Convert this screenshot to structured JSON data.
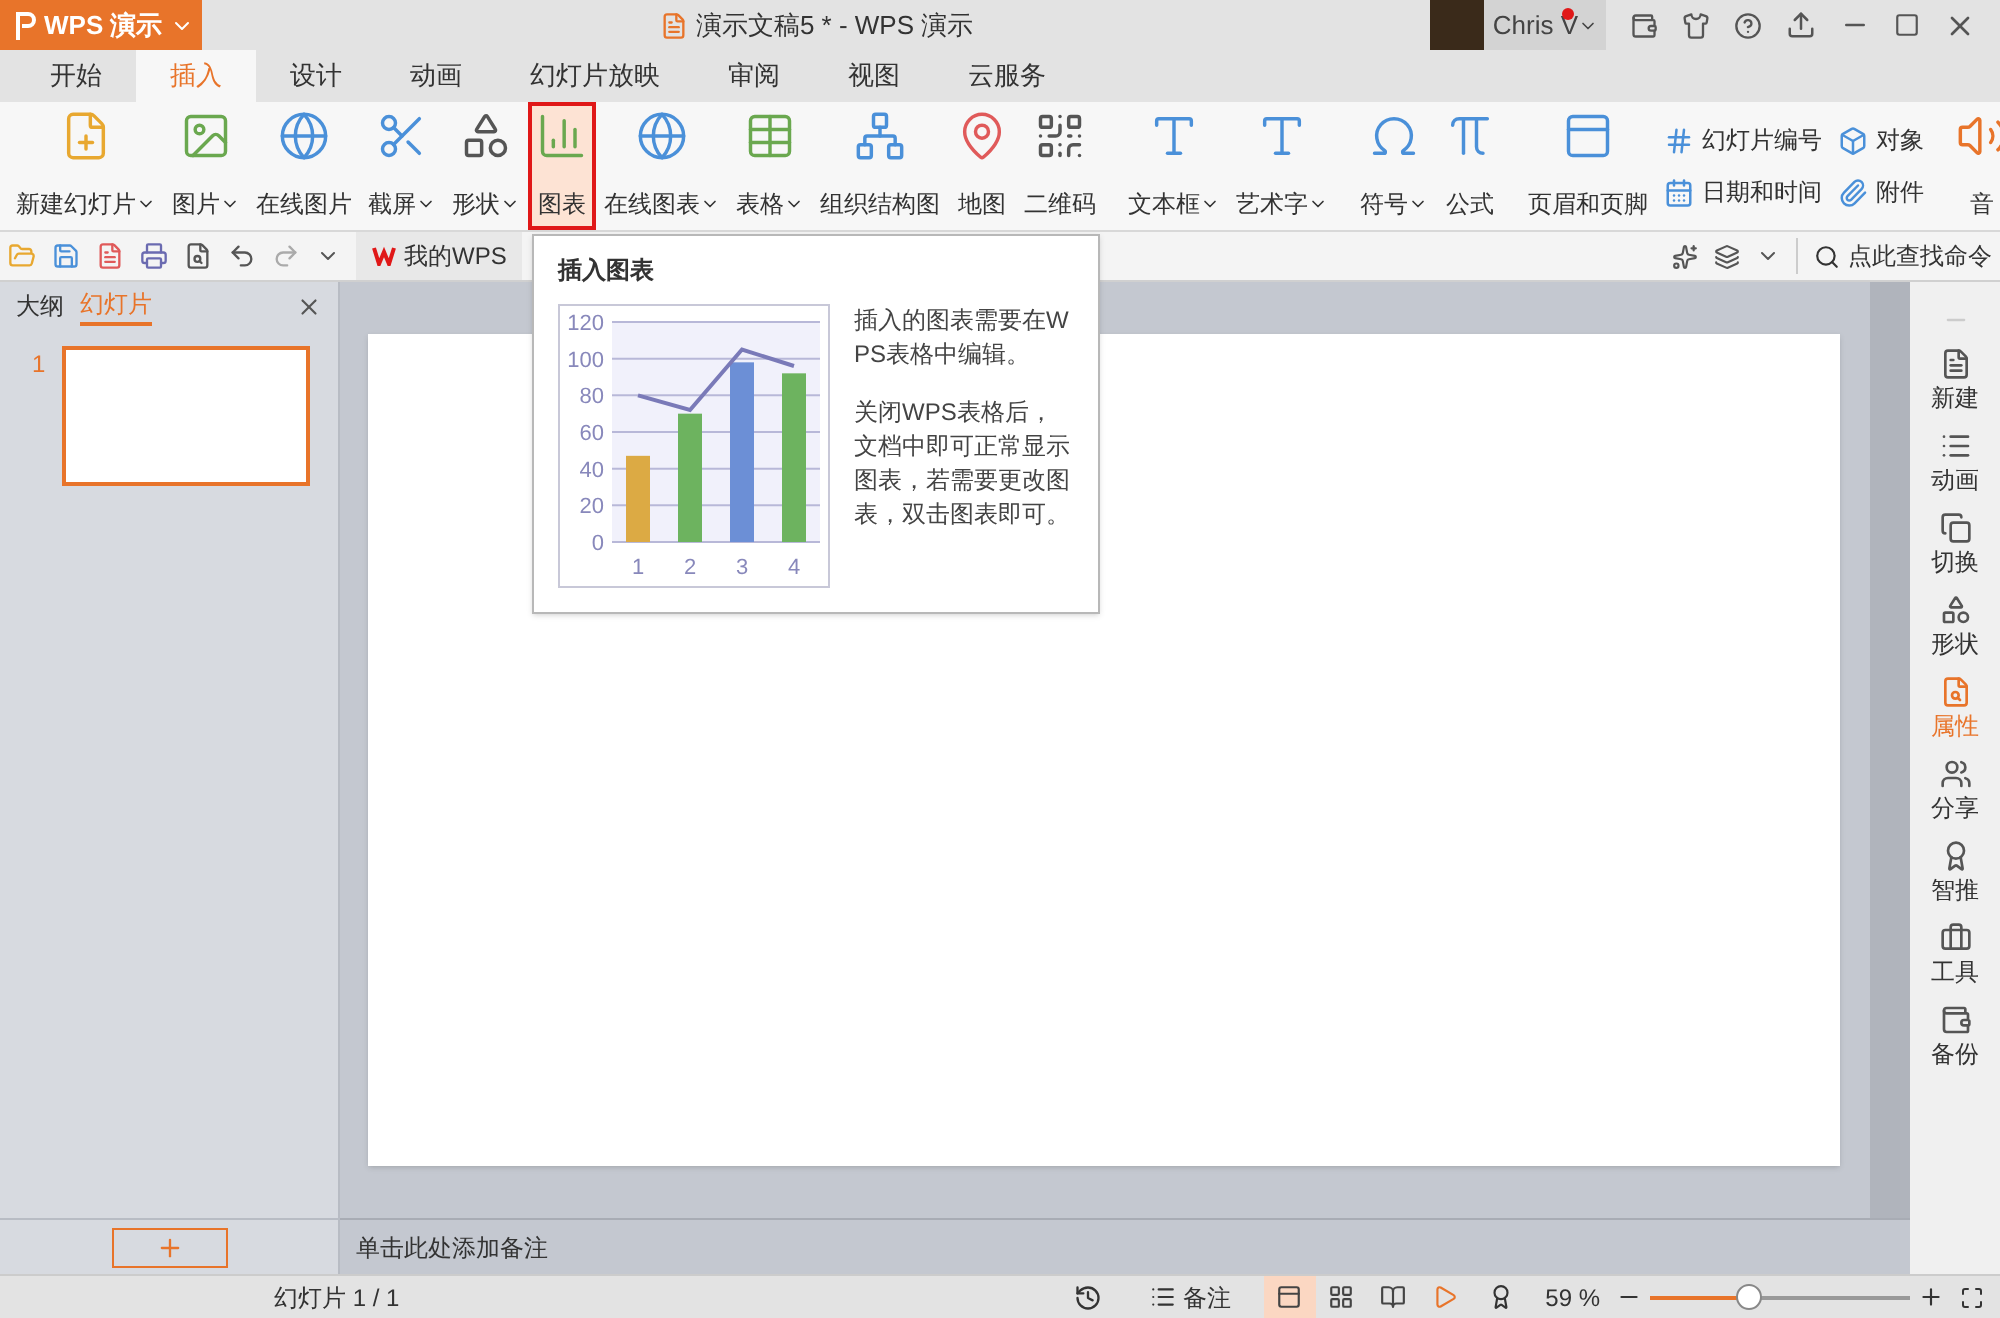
{
  "title_bar": {
    "app_button": "WPS 演示",
    "document_title": "演示文稿5 * - WPS 演示",
    "user_name": "Chris V",
    "notification": true
  },
  "tabs": [
    {
      "label": "开始",
      "selected": false
    },
    {
      "label": "插入",
      "selected": true
    },
    {
      "label": "设计",
      "selected": false
    },
    {
      "label": "动画",
      "selected": false
    },
    {
      "label": "幻灯片放映",
      "selected": false
    },
    {
      "label": "审阅",
      "selected": false
    },
    {
      "label": "视图",
      "selected": false
    },
    {
      "label": "云服务",
      "selected": false
    }
  ],
  "ribbon": [
    {
      "kind": "large",
      "label": "新建幻灯片",
      "dropdown": true,
      "selected": false
    },
    {
      "kind": "large",
      "label": "图片",
      "dropdown": true,
      "selected": false
    },
    {
      "kind": "large",
      "label": "在线图片",
      "dropdown": false,
      "selected": false
    },
    {
      "kind": "large",
      "label": "截屏",
      "dropdown": true,
      "selected": false
    },
    {
      "kind": "large",
      "label": "形状",
      "dropdown": true,
      "selected": false
    },
    {
      "kind": "large",
      "label": "图表",
      "dropdown": false,
      "selected": true
    },
    {
      "kind": "large",
      "label": "在线图表",
      "dropdown": true,
      "selected": false
    },
    {
      "kind": "large",
      "label": "表格",
      "dropdown": true,
      "selected": false
    },
    {
      "kind": "large",
      "label": "组织结构图",
      "dropdown": false,
      "selected": false
    },
    {
      "kind": "large",
      "label": "地图",
      "dropdown": false,
      "selected": false
    },
    {
      "kind": "large",
      "label": "二维码",
      "dropdown": false,
      "selected": false
    },
    {
      "kind": "separator"
    },
    {
      "kind": "large",
      "label": "文本框",
      "dropdown": true,
      "selected": false
    },
    {
      "kind": "large",
      "label": "艺术字",
      "dropdown": true,
      "selected": false
    },
    {
      "kind": "separator"
    },
    {
      "kind": "large",
      "label": "符号",
      "dropdown": true,
      "selected": false
    },
    {
      "kind": "large",
      "label": "公式",
      "dropdown": false,
      "selected": false
    },
    {
      "kind": "separator"
    },
    {
      "kind": "large",
      "label": "页眉和页脚",
      "dropdown": false,
      "selected": false
    },
    {
      "kind": "pair",
      "items": [
        "幻灯片编号",
        "日期和时间"
      ]
    },
    {
      "kind": "pair",
      "items": [
        "对象",
        "附件"
      ]
    },
    {
      "kind": "separator"
    },
    {
      "kind": "large",
      "label": "音",
      "dropdown": false,
      "selected": false
    }
  ],
  "quick_toolbar": {
    "my_wps": "我的WPS",
    "search": "点此查找命令"
  },
  "tooltip": {
    "title": "插入图表",
    "paragraphs": [
      "插入的图表需要在WPS表格中编辑。",
      "关闭WPS表格后，文档中即可正常显示图表，若需要更改图表，双击图表即可。"
    ],
    "chart_data": {
      "type": "bar",
      "categories": [
        "1",
        "2",
        "3",
        "4"
      ],
      "ylim": [
        0,
        120
      ],
      "yticks": [
        0,
        20,
        40,
        60,
        80,
        100,
        120
      ],
      "grid": true,
      "series": [
        {
          "type": "bar",
          "colors": [
            "#dcaa44",
            "#6db35f",
            "#6c8fd6",
            "#6db35f"
          ],
          "values": [
            47,
            70,
            98,
            92
          ]
        },
        {
          "type": "line",
          "values": [
            80,
            72,
            105,
            96
          ]
        }
      ]
    }
  },
  "left_panel": {
    "tabs": [
      {
        "label": "大纲",
        "selected": false
      },
      {
        "label": "幻灯片",
        "selected": true
      }
    ],
    "slides": [
      {
        "number": "1",
        "selected": true
      }
    ]
  },
  "notes_placeholder": "单击此处添加备注",
  "right_sidebar": [
    {
      "label": "新建",
      "selected": false
    },
    {
      "label": "动画",
      "selected": false
    },
    {
      "label": "切换",
      "selected": false
    },
    {
      "label": "形状",
      "selected": false
    },
    {
      "label": "属性",
      "selected": true
    },
    {
      "label": "分享",
      "selected": false
    },
    {
      "label": "智推",
      "selected": false
    },
    {
      "label": "工具",
      "selected": false
    },
    {
      "label": "备份",
      "selected": false
    }
  ],
  "status_bar": {
    "slide_info": "幻灯片 1 / 1",
    "notes": "备注",
    "zoom": "59 %",
    "zoom_slider": {
      "level": 0.38
    },
    "view_buttons": [
      {
        "selected": true
      },
      {
        "selected": false
      },
      {
        "selected": false
      },
      {
        "selected": false
      }
    ]
  }
}
